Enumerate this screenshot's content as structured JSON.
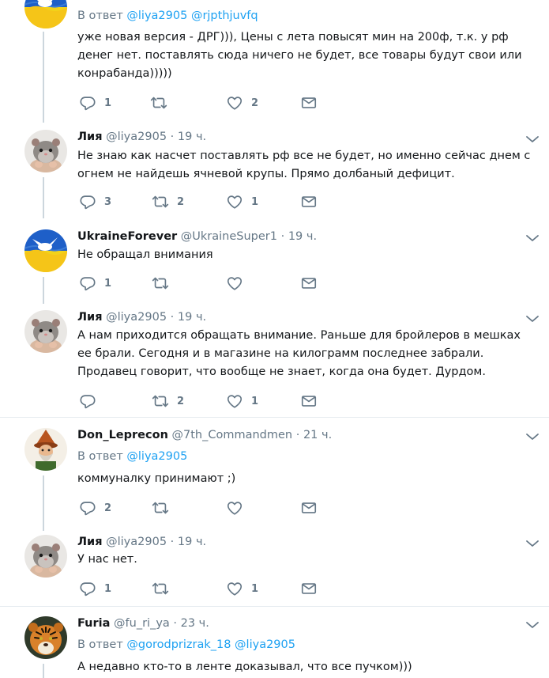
{
  "tweets": [
    {
      "name": "",
      "handle": "",
      "time": "",
      "reply_prefix": "В ответ",
      "reply_mentions": "@liya2905 @rjpthjuvfq",
      "text": "уже новая версия - ДРГ))), Цены с лета повысят мин на 200ф, т.к. у рф денег нет. поставлять сюда ничего не будет, все товары будут свои или конрабанда)))))",
      "replies": "1",
      "retweets": "",
      "likes": "2",
      "avatar": "ukraine-flag-avatar"
    },
    {
      "name": "Лия",
      "handle": "@liya2905",
      "time": "· 19 ч.",
      "text": "Не знаю как насчет поставлять рф все не будет, но именно сейчас днем с огнем не найдешь ячневой крупы. Прямо долбаный дефицит.",
      "replies": "3",
      "retweets": "2",
      "likes": "1",
      "avatar": "hamster-avatar"
    },
    {
      "name": "UkraineForever",
      "handle": "@UkraineSuper1",
      "time": "· 19 ч.",
      "text": "Не обращал внимания",
      "replies": "1",
      "retweets": "",
      "likes": "",
      "avatar": "ukraine-flag-avatar"
    },
    {
      "name": "Лия",
      "handle": "@liya2905",
      "time": "· 19 ч.",
      "text": "А нам приходится обращать внимание. Раньше для бройлеров в мешках ее брали. Сегодня и в магазине на килограмм последнее забрали. Продавец говорит, что вообще не знает, когда она будет. Дурдом.",
      "replies": "",
      "retweets": "2",
      "likes": "1",
      "avatar": "hamster-avatar"
    },
    {
      "name": "Don_Leprecon",
      "handle": "@7th_Commandmen",
      "time": "· 21 ч.",
      "reply_prefix": "В ответ",
      "reply_mentions": "@liya2905",
      "text": "коммуналку принимают ;)",
      "replies": "2",
      "retweets": "",
      "likes": "",
      "avatar": "gnome-avatar"
    },
    {
      "name": "Лия",
      "handle": "@liya2905",
      "time": "· 19 ч.",
      "text": "У нас нет.",
      "replies": "1",
      "retweets": "",
      "likes": "1",
      "avatar": "hamster-avatar"
    },
    {
      "name": "Furia",
      "handle": "@fu_ri_ya",
      "time": "· 23 ч.",
      "reply_prefix": "В ответ",
      "reply_mentions": "@gorodprizrak_18 @liya2905",
      "text": "А недавно кто-то в ленте доказывал, что все пучком)))",
      "avatar": "tiger-avatar"
    }
  ],
  "colors": {
    "accent": "#1da1f2",
    "secondary_text": "#657786",
    "icon": "#657786",
    "thread_line": "#ccd6dd",
    "divider": "#e6ecf0"
  }
}
